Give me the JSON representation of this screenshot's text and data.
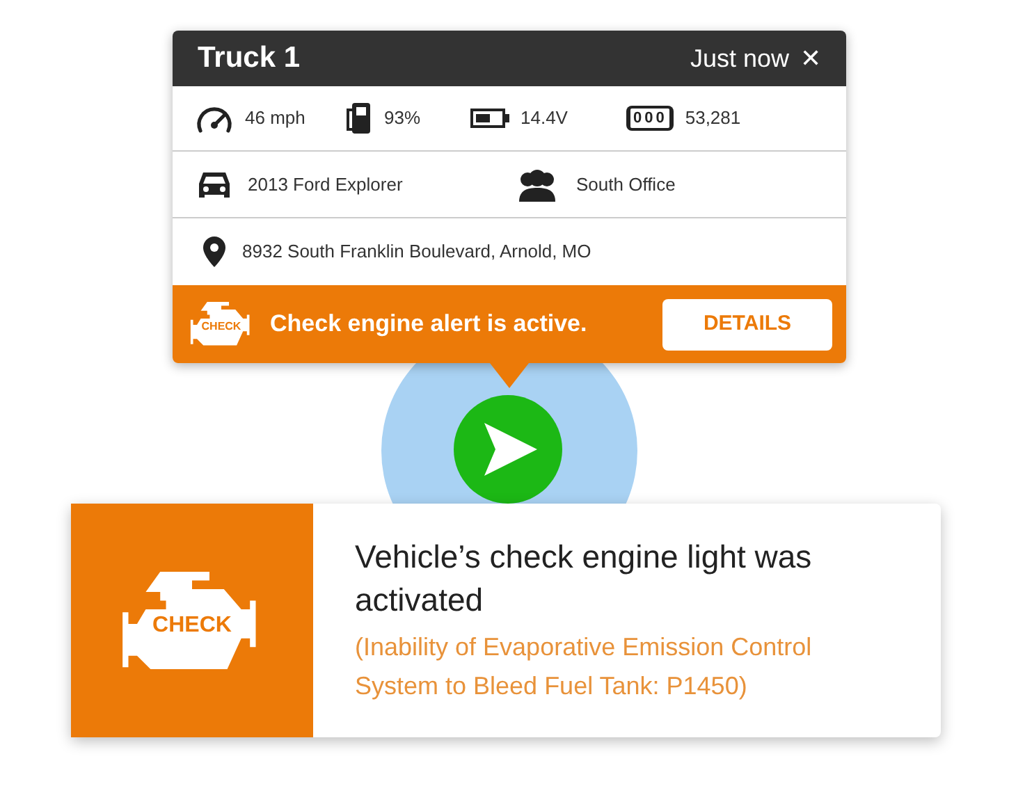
{
  "popup": {
    "title": "Truck 1",
    "time": "Just now",
    "close": "✕",
    "stats": [
      {
        "kind": "speed",
        "value": "46 mph"
      },
      {
        "kind": "fuel",
        "value": "93%"
      },
      {
        "kind": "battery",
        "value": "14.4V"
      },
      {
        "kind": "odometer",
        "digits": "000",
        "value": "53,281"
      }
    ],
    "vehicle": "2013 Ford Explorer",
    "group": "South Office",
    "address": "8932 South Franklin Boulevard, Arnold, MO",
    "alert": {
      "icon_text": "CHECK",
      "message": "Check engine alert is active.",
      "button": "DETAILS"
    }
  },
  "notification": {
    "icon_text": "CHECK",
    "title": "Vehicle’s check engine light was activated",
    "detail": "(Inability of Evaporative Emission Control System to Bleed Fuel Tank: P1450)"
  }
}
